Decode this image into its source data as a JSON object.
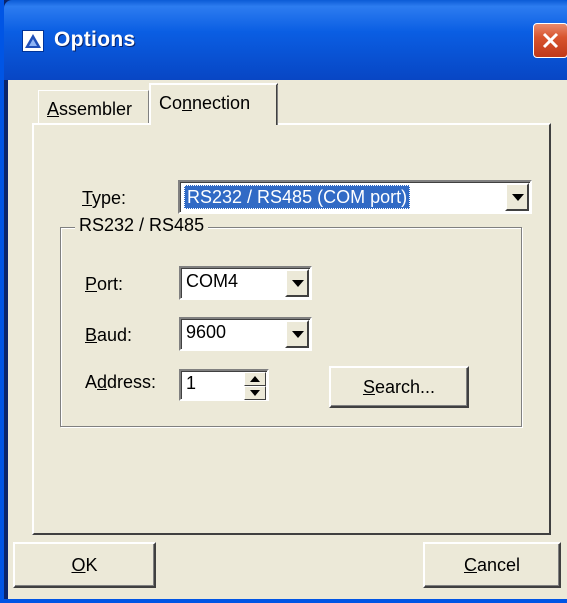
{
  "window": {
    "title": "Options"
  },
  "tabs": [
    {
      "label": "Assembler",
      "mnemonic": "A",
      "rest": "ssembler",
      "active": false
    },
    {
      "label": "Connection",
      "pre": "Co",
      "mnemonic": "n",
      "rest": "nection",
      "active": true
    }
  ],
  "connection": {
    "type": {
      "label_mnemonic": "T",
      "label_rest": "ype:",
      "value": "RS232 / RS485 (COM port)"
    },
    "group": {
      "legend": "RS232 / RS485",
      "port": {
        "label_mnemonic": "P",
        "label_rest": "ort:",
        "value": "COM4"
      },
      "baud": {
        "label_mnemonic": "B",
        "label_rest": "aud:",
        "value": "9600"
      },
      "address": {
        "label_pre": "A",
        "label_mnemonic": "d",
        "label_rest": "dress:",
        "value": "1"
      },
      "search_button": {
        "mnemonic": "S",
        "rest": "earch..."
      }
    }
  },
  "footer": {
    "ok": {
      "mnemonic": "O",
      "rest": "K"
    },
    "cancel": {
      "mnemonic": "C",
      "rest": "ancel"
    }
  },
  "colors": {
    "titlebar": "#0a5ee3",
    "face": "#ece9d8",
    "selection": "#316ac5",
    "close": "#d8552f"
  },
  "icons": {
    "title": "app-triangle-icon",
    "close": "close-icon",
    "dropdown": "chevron-down-icon",
    "spin_up": "spin-up-icon",
    "spin_down": "spin-down-icon"
  }
}
